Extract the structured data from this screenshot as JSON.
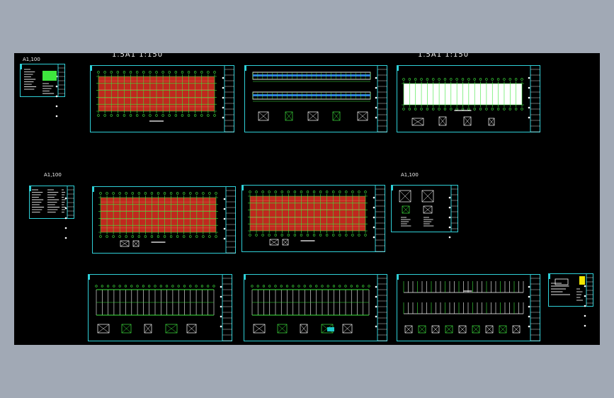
{
  "canvas": {
    "background": "#a1a9b5",
    "model_space": "#000000",
    "frame_color": "#2fd0d8",
    "drawing_green": "#3ee63e",
    "drawing_red": "#c0281e",
    "drawing_white": "#ffffff"
  },
  "labels": {
    "scale_left": "1.5A1  1:150",
    "scale_right": "1.5A1  1:150",
    "sheet_group_a": "A1,100",
    "sheet_group_b": "A1,100",
    "sheet_group_c": "A1,100"
  },
  "sheets": [
    {
      "id": "cover",
      "kind": "cover"
    },
    {
      "id": "plan-1",
      "kind": "red-grid"
    },
    {
      "id": "elevations",
      "kind": "elevation"
    },
    {
      "id": "plan-white",
      "kind": "white-plan"
    },
    {
      "id": "notes",
      "kind": "notes"
    },
    {
      "id": "plan-2",
      "kind": "red-grid"
    },
    {
      "id": "plan-3",
      "kind": "red-grid"
    },
    {
      "id": "details",
      "kind": "details"
    },
    {
      "id": "frame-1",
      "kind": "frame"
    },
    {
      "id": "frame-2",
      "kind": "frame"
    },
    {
      "id": "sections",
      "kind": "sections"
    },
    {
      "id": "stamp",
      "kind": "stamp"
    }
  ]
}
